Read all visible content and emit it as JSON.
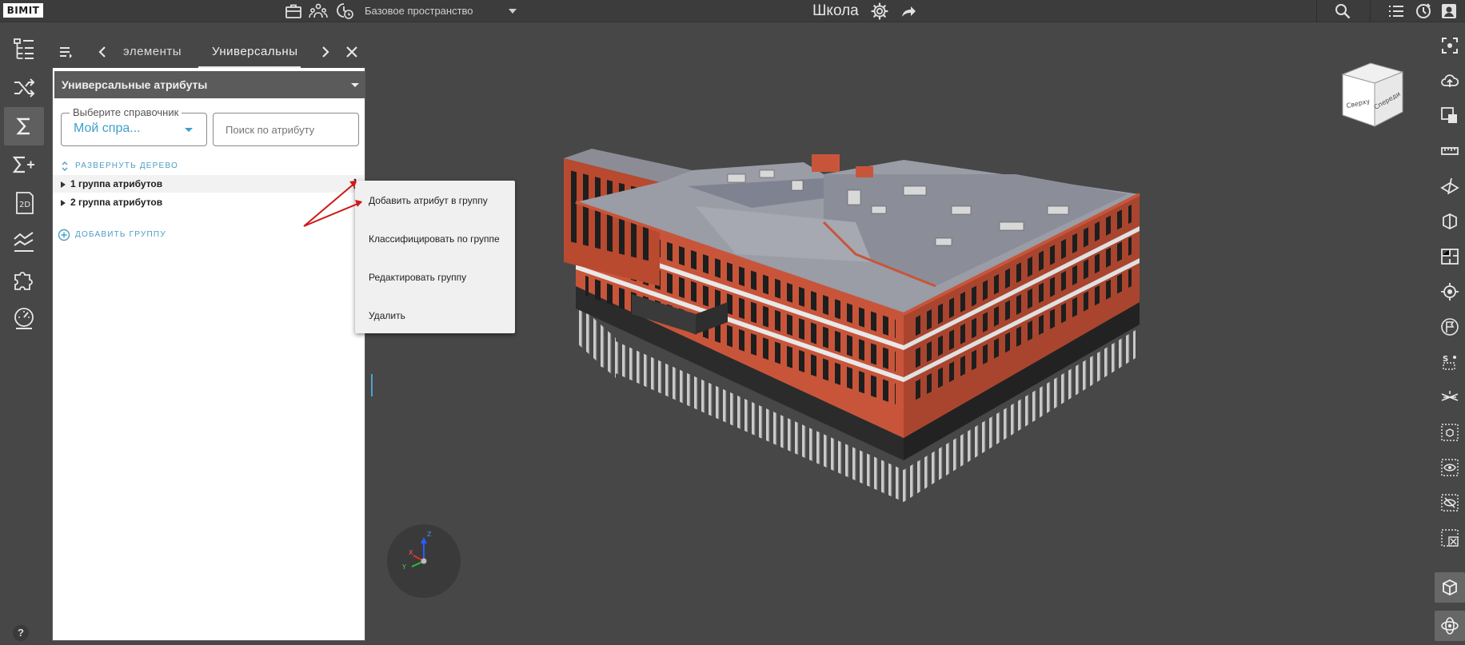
{
  "topbar": {
    "logo": "BIMIT",
    "space_select": "Базовое пространство",
    "project_title": "Школа",
    "icons": [
      "briefcase-icon",
      "team-icon",
      "clock-badge-icon",
      "settings-icon",
      "share-icon",
      "search-icon",
      "list-icon",
      "notifications-icon",
      "user-icon"
    ]
  },
  "left_toolbar": {
    "items": [
      {
        "name": "tree-structure-icon",
        "active": false
      },
      {
        "name": "shuffle-icon",
        "active": false
      },
      {
        "name": "sigma-icon",
        "active": true
      },
      {
        "name": "sigma-plus-icon",
        "active": false
      },
      {
        "name": "2d-sheet-icon",
        "active": false
      },
      {
        "name": "chart-lines-icon",
        "active": false
      },
      {
        "name": "puzzle-icon",
        "active": false
      },
      {
        "name": "gauge-icon",
        "active": false
      }
    ],
    "help": "?"
  },
  "panel": {
    "tabs": [
      "элементы",
      "Универсальны"
    ],
    "active_tab": 1,
    "header": "Универсальные атрибуты",
    "select_legend": "Выберите справочник",
    "select_value": "Мой спра...",
    "search_placeholder": "Поиск по атрибуту",
    "expand_tree": "РАЗВЕРНУТЬ ДЕРЕВО",
    "groups": [
      "1 группа атрибутов",
      "2 группа атрибутов"
    ],
    "add_group": "ДОБАВИТЬ ГРУППУ"
  },
  "context_menu": {
    "items": [
      "Добавить атрибут в группу",
      "Классифицировать по группе",
      "Редактировать группу",
      "Удалить"
    ]
  },
  "viewport": {
    "nav_cube_faces": [
      "Сверху",
      "Спереди"
    ],
    "axes": [
      "Z",
      "X",
      "Y"
    ]
  },
  "right_toolbar": {
    "items": [
      "focus-icon",
      "cloud-upload-icon",
      "select-box-icon",
      "ruler-icon",
      "section-plane-icon",
      "section-box-icon",
      "floor-plan-icon",
      "target-icon",
      "flag-icon",
      "snap-points-icon",
      "grid-axes-icon",
      "isolate-box-icon",
      "show-eye-icon",
      "hide-eye-icon",
      "clear-selection-icon",
      "cube-view-icon",
      "orbit-icon"
    ],
    "active": [
      15,
      16
    ]
  },
  "colors": {
    "accent": "#4a9ec4",
    "building_brick": "#c8553a",
    "background": "#474747"
  }
}
